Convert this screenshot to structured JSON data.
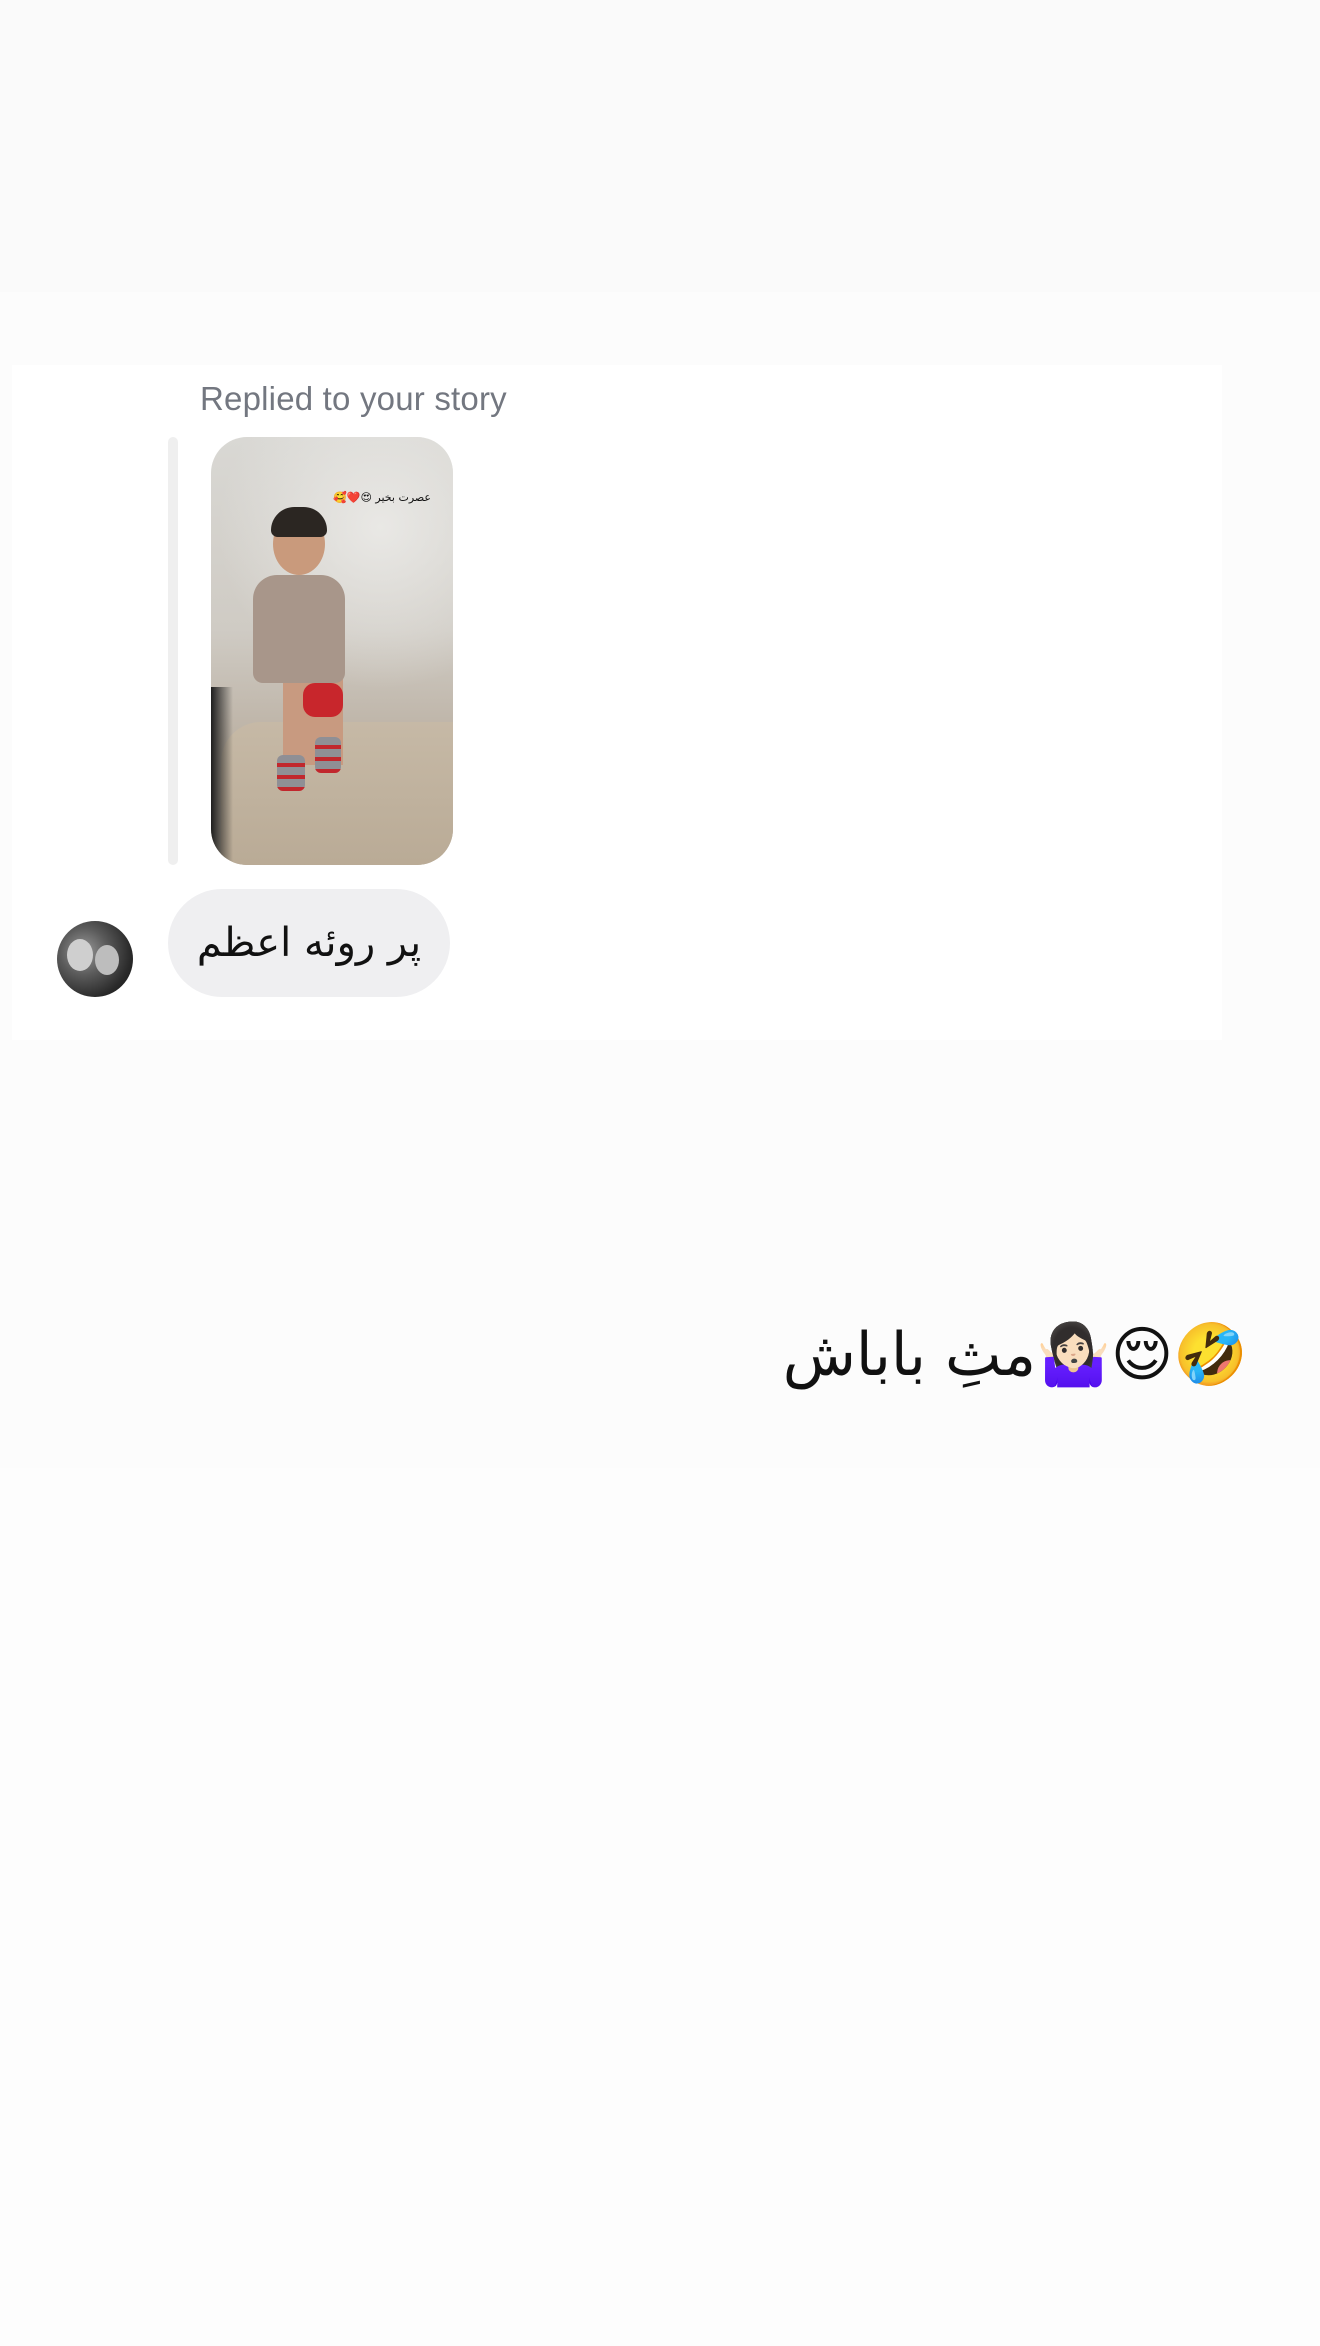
{
  "story_reply": {
    "label": "Replied to your story",
    "story_caption": "عصرت بخیر 😍❤️🥰"
  },
  "incoming_message": {
    "text": "پر روئه اعظم"
  },
  "outgoing_message": {
    "text": "مثِ باباش🤷🏻‍♀️😌🤣"
  },
  "icons": {
    "avatar": "sender-avatar",
    "story": "story-thumbnail"
  },
  "colors": {
    "incoming_bubble": "#efeff1",
    "label_gray": "#737780",
    "quote_bar": "#efefef"
  }
}
